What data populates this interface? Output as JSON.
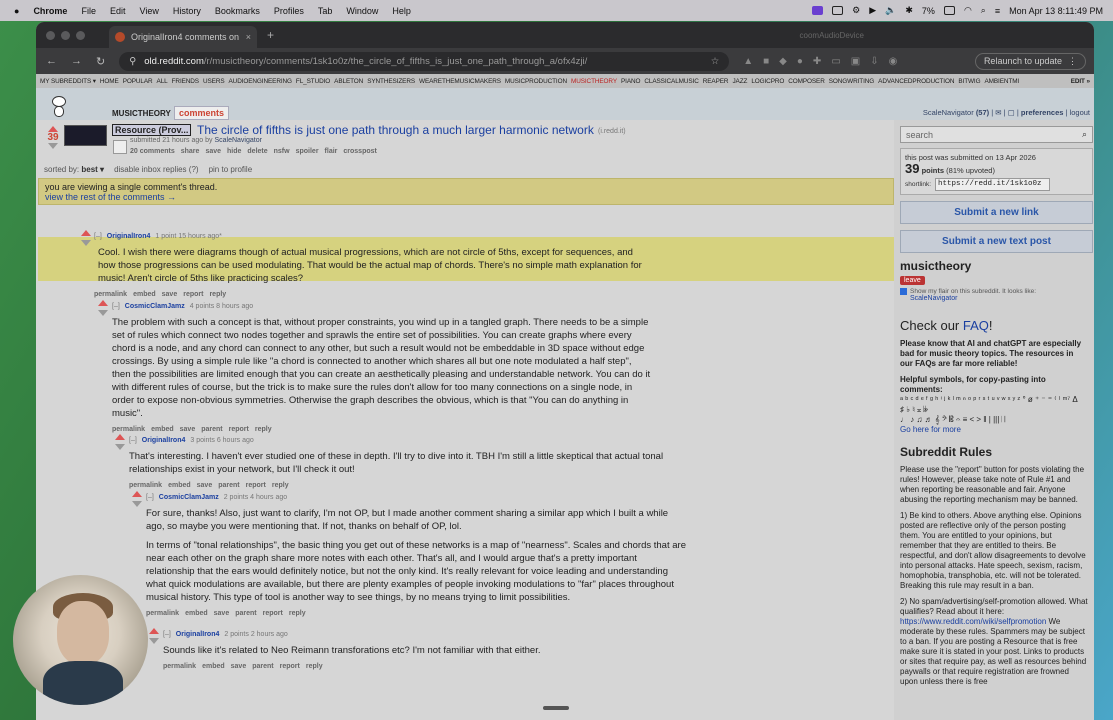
{
  "menubar": {
    "app": "Chrome",
    "items": [
      "File",
      "Edit",
      "View",
      "History",
      "Bookmarks",
      "Profiles",
      "Tab",
      "Window",
      "Help"
    ],
    "battery": "7%",
    "clock": "Mon Apr 13  8:11:49 PM"
  },
  "browser": {
    "tab_title": "OriginalIron4 comments on Th",
    "media_label": "coomAudioDevice",
    "url_host": "old.reddit.com",
    "url_path": "/r/musictheory/comments/1sk1o0z/the_circle_of_fifths_is_just_one_path_through_a/ofx4zji/",
    "relaunch": "Relaunch to update"
  },
  "subreddit_bar": {
    "items": [
      "MY SUBREDDITS ▾",
      "HOME",
      "POPULAR",
      "ALL",
      "FRIENDS",
      "USERS",
      "AUDIOENGINEERING",
      "FL_STUDIO",
      "ABLETON",
      "SYNTHESIZERS",
      "WEARETHEMUSICMAKERS",
      "MUSICPRODUCTION",
      "MUSICTHEORY",
      "PIANO",
      "CLASSICALMUSIC",
      "REAPER",
      "JAZZ",
      "LOGICPRO",
      "COMPOSER",
      "SONGWRITING",
      "ADVANCEDPRODUCTION",
      "BITWIG",
      "AMBIENTMI"
    ],
    "edit": "EDIT »"
  },
  "header": {
    "subreddit": "MUSICTHEORY",
    "tab": "comments",
    "username": "ScaleNavigator",
    "karma": "(57)",
    "preferences": "preferences",
    "logout": "logout"
  },
  "post": {
    "score": "39",
    "flair": "Resource (Prov...",
    "title": "The circle of fifths is just one path through a much larger harmonic network",
    "domain": "(i.redd.it)",
    "meta_prefix": "submitted 21 hours ago by",
    "author": "ScaleNavigator",
    "links": [
      "20 comments",
      "share",
      "save",
      "hide",
      "delete",
      "nsfw",
      "spoiler",
      "flair",
      "crosspost"
    ],
    "sorted_label": "sorted by:",
    "sort": "best ▾",
    "disable_replies": "disable inbox replies",
    "help": "(?)",
    "pin": "pin to profile"
  },
  "single_thread": {
    "line1": "you are viewing a single comment's thread.",
    "line2": "view the rest of the comments →"
  },
  "comments": [
    {
      "user": "OriginalIron4",
      "meta": "1 point 15 hours ago*",
      "text": "Cool. I wish there were diagrams though of actual musical progressions, which are not circle of 5ths, except for sequences, and how those progressions can be used modulating. That would be the actual map of chords. There's no simple math explanation for music! Aren't circle of 5ths like practicing scales?",
      "actions": [
        "permalink",
        "embed",
        "save",
        "report",
        "reply"
      ]
    },
    {
      "user": "CosmicClamJamz",
      "meta": "4 points 8 hours ago",
      "text": "The problem with such a concept is that, without proper constraints, you wind up in a tangled graph. There needs to be a simple set of rules which connect two nodes together and sprawls the entire set of possibilities. You can create graphs where every chord is a node, and any chord can connect to any other, but such a result would not be embeddable in 3D space without edge crossings. By using a simple rule like \"a chord is connected to another which shares all but one note modulated a half step\", then the possibilities are limited enough that you can create an aesthetically pleasing and understandable network. You can do it with different rules of course, but the trick is to make sure the rules don't allow for too many connections on a single node, in order to expose non-obvious symmetries. Otherwise the graph describes the obvious, which is that \"You can do anything in music\".",
      "actions": [
        "permalink",
        "embed",
        "save",
        "parent",
        "report",
        "reply"
      ]
    },
    {
      "user": "OriginalIron4",
      "meta": "3 points 6 hours ago",
      "text": "That's interesting. I haven't ever studied one of these in depth. I'll try to dive into it. TBH I'm still a little skeptical that actual tonal relationships exist in your network, but I'll check it out!",
      "actions": [
        "permalink",
        "embed",
        "save",
        "parent",
        "report",
        "reply"
      ]
    },
    {
      "user": "CosmicClamJamz",
      "meta": "2 points 4 hours ago",
      "text": "For sure, thanks! Also, just want to clarify, I'm not OP, but I made another comment sharing a similar app which I built a while ago, so maybe you were mentioning that. If not, thanks on behalf of OP, lol.",
      "text2": "In terms of \"tonal relationships\", the basic thing you get out of these networks is a map of \"nearness\". Scales and chords that are near each other on the graph share more notes with each other. That's all, and I would argue that's a pretty important relationship that the ears would definitely notice, but not the only kind. It's really relevant for voice leading and understanding what quick modulations are available, but there are plenty examples of people invoking modulations to \"far\" places throughout musical history. This type of tool is another way to see things, by no means trying to limit possibilities.",
      "actions": [
        "permalink",
        "embed",
        "save",
        "parent",
        "report",
        "reply"
      ]
    },
    {
      "user": "OriginalIron4",
      "meta": "2 points 2 hours ago",
      "text": "Sounds like it's related to Neo Reimann transforations etc? I'm not familiar with that either.",
      "actions": [
        "permalink",
        "embed",
        "save",
        "parent",
        "report",
        "reply"
      ]
    }
  ],
  "sidebar": {
    "search_placeholder": "search",
    "submitted_on": "this post was submitted on 13 Apr 2026",
    "points": "39",
    "points_label": "points",
    "upvoted": "(81% upvoted)",
    "shortlink_label": "shortlink:",
    "shortlink": "https://redd.it/1sk1o0z",
    "submit_link": "Submit a new link",
    "submit_text": "Submit a new text post",
    "sub_name": "musictheory",
    "leave": "leave",
    "flair_text": "Show my flair on this subreddit. It looks like:",
    "flair_user": "ScaleNavigator",
    "faq_prefix": "Check our ",
    "faq_link": "FAQ",
    "faq_suffix": "!",
    "ai_note": "Please know that AI and chatGPT are especially bad for music theory topics. The resources in our FAQs are far more reliable!",
    "symbols_title": "Helpful symbols, for copy-pasting into comments:",
    "symbols1": "ᵃ ᵇ ᶜ ᵈ ᵉ ᶠ ᵍ ʰ ⁱ ʲ ᵏ ˡ ᵐ ⁿ ᵒ ᵖ ʳ ˢ ᵗ ᵘ ᵛ ʷ ˣ ʸ ᶻ ° ø ⁺ ⁻ ⁼ ⁽ ⁾ ᵐ⁷ Δ",
    "symbols2": "♯ ♭ ♮ 𝄪 𝄫",
    "symbols3": "♩ ♪ ♫ ♬ 𝄞 𝄢 𝄡 𝄐 ≡ < > ‖ | ||| 𝄀 𝄁",
    "go_here": "Go here for more",
    "rules_title": "Subreddit Rules",
    "rules_intro": "Please use the \"report\" button for posts violating the rules! However, please take note of Rule #1 and when reporting be reasonable and fair. Anyone abusing the reporting mechanism may be banned.",
    "rule1": "1) Be kind to others. Above anything else. Opinions posted are reflective only of the person posting them. You are entitled to your opinions, but remember that they are entitled to theirs. Be respectful, and don't allow disagreements to devolve into personal attacks. Hate speech, sexism, racism, homophobia, transphobia, etc. will not be tolerated. Breaking this rule may result in a ban.",
    "rule2": "2) No spam/advertising/self-promotion allowed. What qualifies? Read about it here:",
    "rule2_link": "https://www.reddit.com/wiki/selfpromotion",
    "rule2_cont": "We moderate by these rules. Spammers may be subject to a ban. If you are posting a Resource that is free make sure it is stated in your post. Links to products or sites that require pay, as well as resources behind paywalls or that require registration are frowned upon unless there is free"
  }
}
